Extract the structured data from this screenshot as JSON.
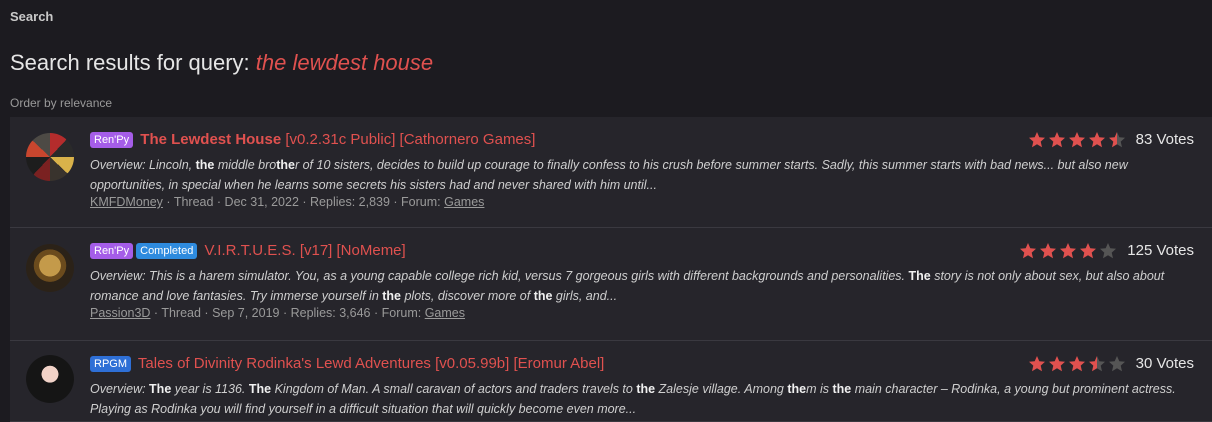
{
  "page": {
    "section_label": "Search",
    "heading_prefix": "Search results for query:",
    "query": "the lewdest house",
    "order_label": "Order by relevance"
  },
  "colors": {
    "accent": "#e0514f",
    "star": "#e0514f",
    "star_empty": "#555555",
    "renpy": "#a55de8",
    "completed": "#2e8bde",
    "rpgm": "#2e6fd6"
  },
  "results": [
    {
      "badges": [
        "Ren'Py"
      ],
      "title_name": "The Lewdest House",
      "title_rest": " [v0.2.31c Public] [Cathornero Games]",
      "overview_1": "Overview: Lincoln, ",
      "overview_b1": "the",
      "overview_2": " middle bro",
      "overview_b2": "the",
      "overview_3": "r of 10 sisters, decides to build up courage to finally confess to his crush before summer starts. Sadly, this summer starts with bad news... but also new opportunities, in special when he learns some secrets his sisters had and never shared with him until...",
      "author": "KMFDMoney",
      "type": "Thread",
      "date": "Dec 31, 2022",
      "replies": "Replies: 2,839",
      "forum_label": "Forum:",
      "forum": "Games",
      "rating": 4.5,
      "votes": "83 Votes"
    },
    {
      "badges": [
        "Ren'Py",
        "Completed"
      ],
      "title_name": "V.I.R.T.U.E.S.",
      "title_rest": " [v17] [NoMeme]",
      "overview_1": "Overview: This is a harem simulator. You, as a young capable college rich kid, versus 7 gorgeous girls with different backgrounds and personalities. ",
      "overview_b1": "The",
      "overview_2": " story is not only about sex, but also about romance and love fantasies. Try immerse yourself in ",
      "overview_b2": "the",
      "overview_3": " plots, discover more of ",
      "overview_b3": "the",
      "overview_4": " girls, and...",
      "author": "Passion3D",
      "type": "Thread",
      "date": "Sep 7, 2019",
      "replies": "Replies: 3,646",
      "forum_label": "Forum:",
      "forum": "Games",
      "rating": 4,
      "votes": "125 Votes"
    },
    {
      "badges": [
        "RPGM"
      ],
      "title_name": "Tales of Divinity Rodinka's Lewd Adventures",
      "title_rest": " [v0.05.99b] [Eromur Abel]",
      "overview_1": "Overview: ",
      "overview_b1": "The",
      "overview_2": " year is 1136. ",
      "overview_b2": "The",
      "overview_3": " Kingdom of Man. A small caravan of actors and traders travels to ",
      "overview_b3": "the",
      "overview_4": " Zalesje village. Among ",
      "overview_b4": "the",
      "overview_5": "m is ",
      "overview_b5": "the",
      "overview_6": " main character – Rodinka, a young but prominent actress. Playing as Rodinka you will find yourself in a difficult situation that will quickly become even more...",
      "rating": 3.5,
      "votes": "30 Votes"
    }
  ]
}
